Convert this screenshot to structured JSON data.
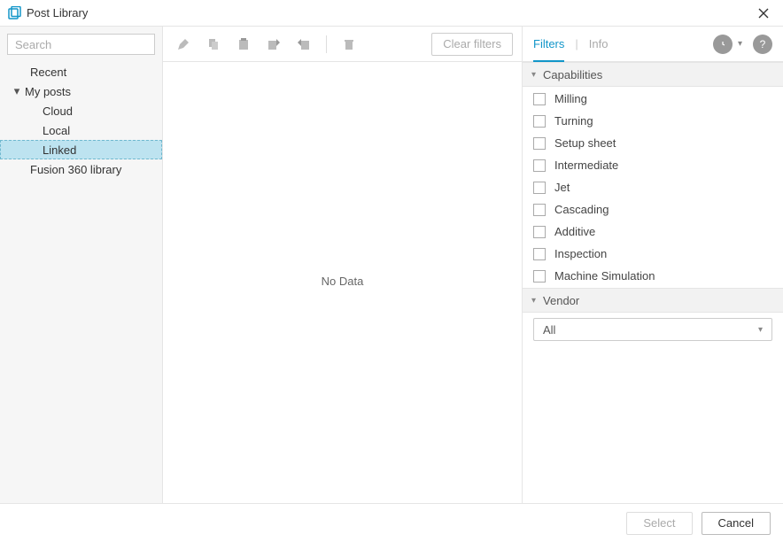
{
  "title": "Post Library",
  "search": {
    "placeholder": "Search",
    "value": ""
  },
  "tree": {
    "recent": "Recent",
    "my_posts": "My posts",
    "cloud": "Cloud",
    "local": "Local",
    "linked": "Linked",
    "fusion_lib": "Fusion 360 library"
  },
  "toolbar": {
    "clear_filters": "Clear filters"
  },
  "center": {
    "no_data": "No Data"
  },
  "right": {
    "tabs": {
      "filters": "Filters",
      "info": "Info"
    },
    "sections": {
      "capabilities": {
        "label": "Capabilities",
        "items": [
          "Milling",
          "Turning",
          "Setup sheet",
          "Intermediate",
          "Jet",
          "Cascading",
          "Additive",
          "Inspection",
          "Machine Simulation"
        ]
      },
      "vendor": {
        "label": "Vendor",
        "selected": "All"
      }
    }
  },
  "footer": {
    "select": "Select",
    "cancel": "Cancel"
  }
}
